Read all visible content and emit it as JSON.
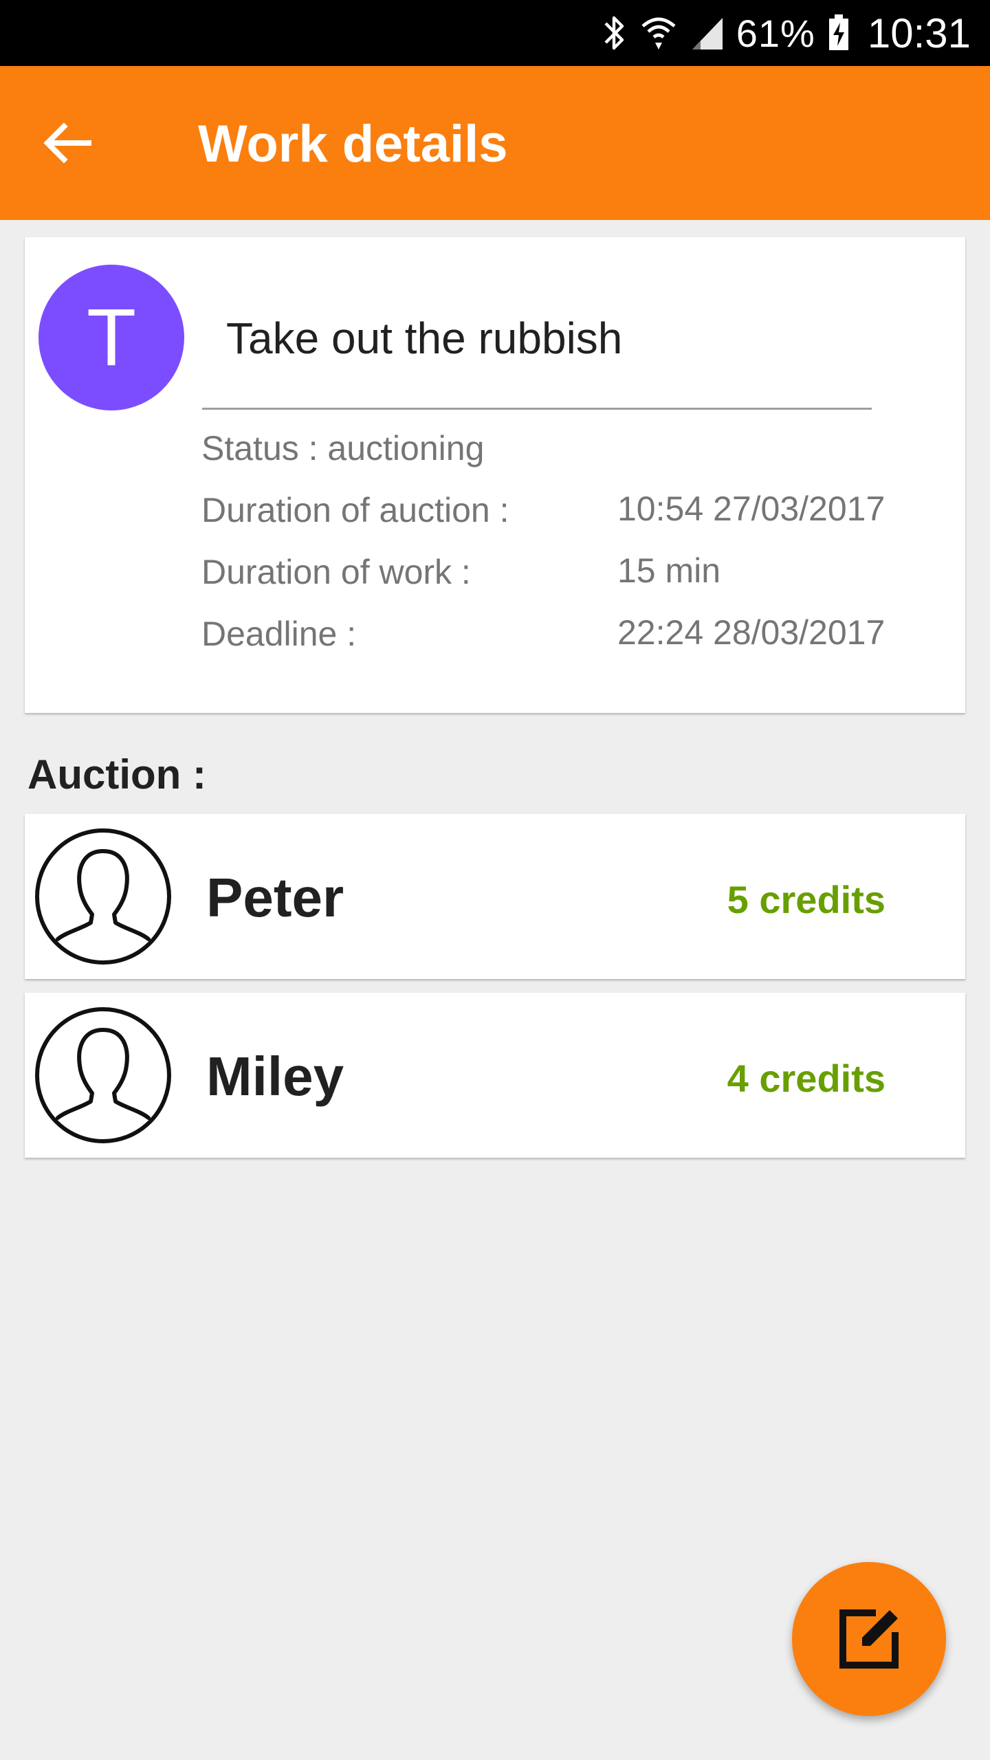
{
  "status_bar": {
    "battery_percent": "61%",
    "time": "10:31"
  },
  "app_bar": {
    "title": "Work details",
    "back_icon": "arrow-back-icon"
  },
  "work": {
    "avatar_letter": "T",
    "avatar_color": "#7c4dff",
    "title": "Take out the rubbish",
    "status": "Status : auctioning",
    "details": [
      {
        "label": "Duration of auction :",
        "value": "10:54 27/03/2017"
      },
      {
        "label": "Duration of work :",
        "value": "15 min"
      },
      {
        "label": "Deadline :",
        "value": "22:24 28/03/2017"
      }
    ]
  },
  "auction": {
    "label": "Auction :",
    "bids": [
      {
        "name": "Peter",
        "credits": "5 credits"
      },
      {
        "name": "Miley",
        "credits": "4 credits"
      }
    ]
  },
  "fab": {
    "icon": "edit-icon"
  },
  "colors": {
    "accent": "#fa7f0e",
    "credits": "#689f00",
    "background": "#eeeeee"
  }
}
